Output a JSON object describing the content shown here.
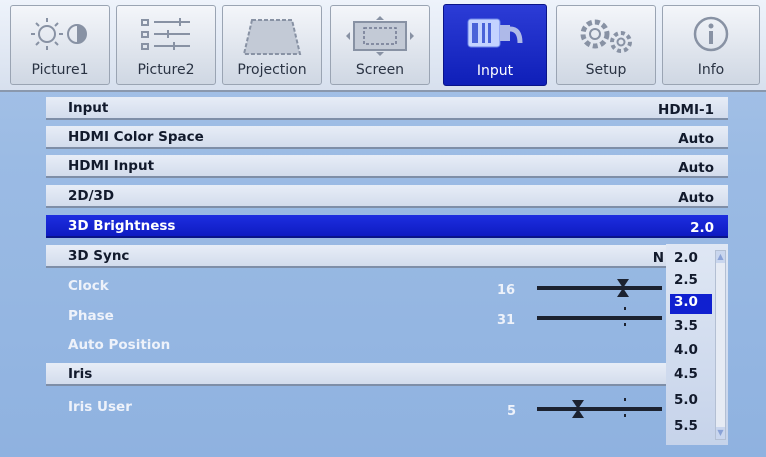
{
  "tabs": [
    {
      "label": "Picture1",
      "icon": "sun-contrast-icon"
    },
    {
      "label": "Picture2",
      "icon": "sliders-icon"
    },
    {
      "label": "Projection",
      "icon": "keystone-icon"
    },
    {
      "label": "Screen",
      "icon": "screen-crop-icon"
    },
    {
      "label": "Input",
      "icon": "hdmi-plug-icon",
      "active": true
    },
    {
      "label": "Setup",
      "icon": "gears-icon"
    },
    {
      "label": "Info",
      "icon": "info-icon"
    }
  ],
  "menu": {
    "rows": [
      {
        "label": "Input",
        "value": "HDMI-1"
      },
      {
        "label": "HDMI Color Space",
        "value": "Auto"
      },
      {
        "label": "HDMI Input",
        "value": "Auto"
      },
      {
        "label": "2D/3D",
        "value": "Auto"
      },
      {
        "label": "3D Brightness",
        "value": "2.0",
        "selected": true
      },
      {
        "label": "3D Sync",
        "value": "N"
      },
      {
        "label": "Clock",
        "value": "16"
      },
      {
        "label": "Phase",
        "value": "31"
      },
      {
        "label": "Auto Position",
        "value": ""
      },
      {
        "label": "Iris",
        "value": ""
      },
      {
        "label": "Iris User",
        "value": "5"
      }
    ]
  },
  "dropdown": {
    "options": [
      "2.0",
      "2.5",
      "3.0",
      "3.5",
      "4.0",
      "4.5",
      "5.0",
      "5.5"
    ],
    "selected": "3.0"
  },
  "colors": {
    "accent": "#1020d0",
    "panel": "#9bbbe4"
  }
}
